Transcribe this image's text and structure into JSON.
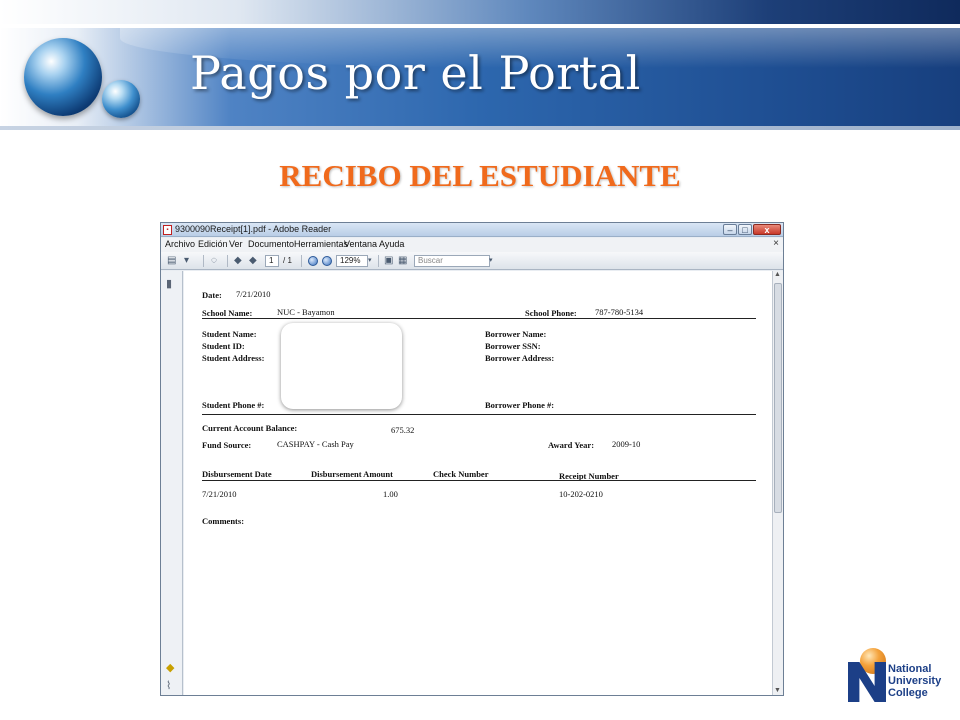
{
  "slide": {
    "title": "Pagos por el Portal",
    "subtitle": "RECIBO DEL ESTUDIANTE"
  },
  "window": {
    "title": "9300090Receipt[1].pdf - Adobe Reader",
    "pdf_icon": "pdf-file-icon",
    "controls": {
      "minimize": "–",
      "maximize": "□",
      "close": "x"
    }
  },
  "menu": {
    "items": [
      "Archivo",
      "Edición",
      "Ver",
      "Documento",
      "Herramientas",
      "Ventana",
      "Ayuda"
    ],
    "close": "×"
  },
  "toolbar": {
    "page_current": "1",
    "page_total": "/ 1",
    "zoom": "129%",
    "search_placeholder": "Buscar",
    "icons": [
      "print-icon",
      "attach-icon",
      "previous-page-icon",
      "next-page-icon",
      "zoom-out-icon",
      "zoom-in-icon",
      "save-icon",
      "fit-page-icon"
    ]
  },
  "receipt": {
    "date_label": "Date:",
    "date_value": "7/21/2010",
    "school_name_label": "School Name:",
    "school_name_value": "NUC - Bayamon",
    "school_phone_label": "School Phone:",
    "school_phone_value": "787-780-5134",
    "student_name_label": "Student Name:",
    "student_id_label": "Student ID:",
    "student_address_label": "Student Address:",
    "student_phone_label": "Student Phone #:",
    "borrower_name_label": "Borrower Name:",
    "borrower_ssn_label": "Borrower SSN:",
    "borrower_address_label": "Borrower Address:",
    "borrower_phone_label": "Borrower Phone #:",
    "balance_label": "Current Account Balance:",
    "balance_value": "675.32",
    "fund_source_label": "Fund Source:",
    "fund_source_value": "CASHPAY - Cash Pay",
    "award_year_label": "Award Year:",
    "award_year_value": "2009-10",
    "table_headers": [
      "Disbursement Date",
      "Disbursement Amount",
      "Check Number",
      "Receipt Number"
    ],
    "table_row": {
      "date": "7/21/2010",
      "amount": "1.00",
      "check": "",
      "receipt": "10-202-0210"
    },
    "comments_label": "Comments:"
  },
  "logo": {
    "line1": "National",
    "line2": "University",
    "line3": "College"
  },
  "colors": {
    "subtitle": "#f06a1c",
    "banner_blue": "#2d67ae",
    "logo_blue": "#1c3f87"
  }
}
